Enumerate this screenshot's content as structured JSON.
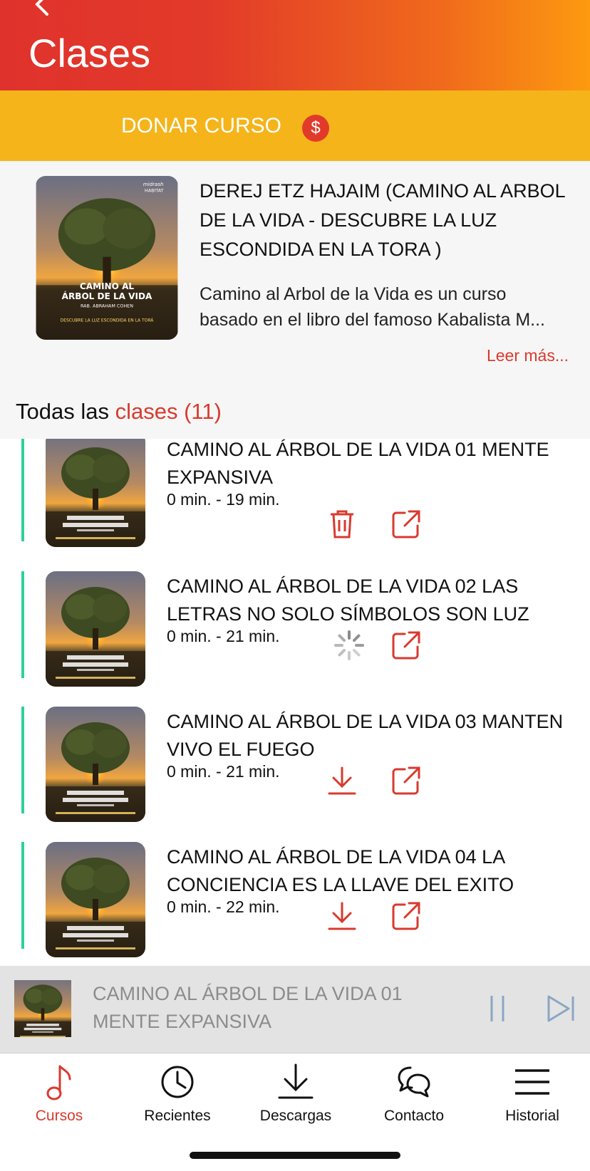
{
  "header": {
    "title": "Clases"
  },
  "donate": {
    "label": "DONAR CURSO",
    "icon_symbol": "$"
  },
  "course": {
    "title": " DEREJ ETZ  HAJAIM  (CAMINO AL ARBOL DE LA VIDA - DESCUBRE LA LUZ ESCONDIDA  EN LA TORA )",
    "description_line1": "Camino al Arbol de la Vida es un curso",
    "description_line2": "basado en el libro del famoso Kabalista M...",
    "read_more": "Leer más...",
    "cover": {
      "brand": "midrash",
      "brand2": "HABITAT",
      "line1": "CAMINO AL",
      "line2": "ÁRBOL DE LA VIDA",
      "author": "RAB. ABRAHAM COHEN",
      "tagline": "DESCUBRE LA LUZ ESCONDIDA EN LA TORÁ"
    }
  },
  "list_header": {
    "prefix": "Todas las",
    "accent": "clases (11)"
  },
  "classes": [
    {
      "title": "CAMINO AL ÁRBOL DE LA VIDA 01 MENTE EXPANSIVA",
      "duration": "0 min. - 19 min.",
      "action_icon": "trash-icon",
      "share_icon": "share-icon"
    },
    {
      "title": "CAMINO AL ÁRBOL DE LA VIDA 02 LAS LETRAS NO SOLO SÍMBOLOS SON LUZ",
      "duration": "0 min. - 21 min.",
      "action_icon": "loading-spinner-icon",
      "share_icon": "share-icon"
    },
    {
      "title": "CAMINO AL ÁRBOL DE LA VIDA 03 MANTEN VIVO EL FUEGO",
      "duration": "0 min. - 21 min.",
      "action_icon": "download-icon",
      "share_icon": "share-icon"
    },
    {
      "title": "CAMINO AL ÁRBOL DE LA VIDA 04 LA CONCIENCIA ES LA LLAVE DEL EXITO",
      "duration": "0 min. - 22 min.",
      "action_icon": "download-icon",
      "share_icon": "share-icon"
    }
  ],
  "player": {
    "title": "CAMINO AL ÁRBOL DE LA VIDA 01 MENTE EXPANSIVA",
    "pause_icon": "pause-icon",
    "next_icon": "skip-next-icon"
  },
  "tabs": [
    {
      "label": "Cursos",
      "icon": "music-note-icon",
      "active": true
    },
    {
      "label": "Recientes",
      "icon": "clock-icon",
      "active": false
    },
    {
      "label": "Descargas",
      "icon": "download-tray-icon",
      "active": false
    },
    {
      "label": "Contacto",
      "icon": "chat-bubbles-icon",
      "active": false
    },
    {
      "label": "Historial",
      "icon": "hamburger-menu-icon",
      "active": false
    }
  ],
  "colors": {
    "accent": "#d93a2e",
    "donate_bg": "#f4b41a",
    "header_start": "#e0322c",
    "header_end": "#fd9a10",
    "progress_bar": "#2ed19c"
  }
}
